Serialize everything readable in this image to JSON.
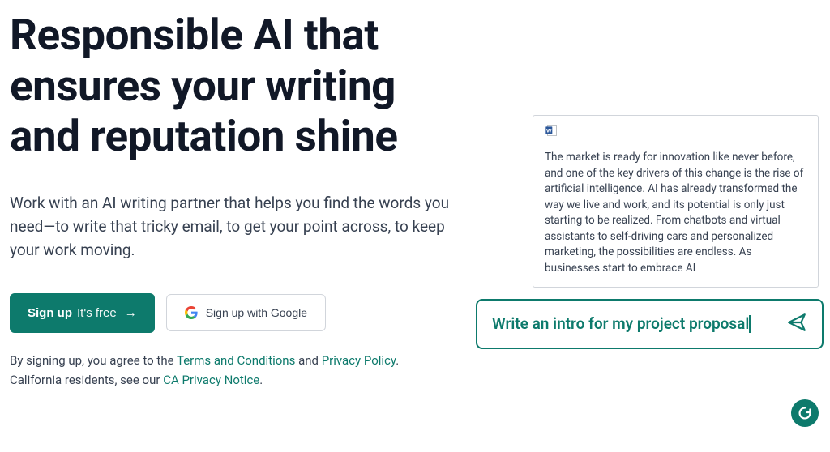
{
  "hero": {
    "headline": "Responsible AI that ensures your writing and reputation shine",
    "subhead": "Work with an AI writing partner that helps you find the words you need—to write that tricky email, to get your point across, to keep your work moving."
  },
  "cta": {
    "primary_bold": "Sign up",
    "primary_light": "It's free",
    "primary_arrow": "→",
    "google_label": "Sign up with Google"
  },
  "legal": {
    "prefix": "By signing up, you agree to the ",
    "terms_label": "Terms and Conditions",
    "and": " and ",
    "privacy_label": "Privacy Policy",
    "period": ".",
    "ca_prefix": "California residents, see our ",
    "ca_label": "CA Privacy Notice",
    "ca_period": "."
  },
  "demo": {
    "doc_text": "The market is ready for innovation like never before, and one of the key drivers of this change is the rise of artificial intelligence. AI has already transformed the way we live and work, and its potential is only just starting to be realized. From chatbots and virtual assistants to self-driving cars and personalized marketing, the possibilities are endless. As businesses start to embrace AI",
    "prompt_text": "Write an intro for my project proposal"
  }
}
